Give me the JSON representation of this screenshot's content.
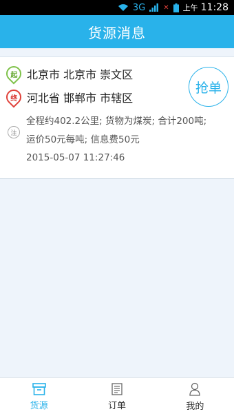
{
  "status_bar": {
    "network": "3G",
    "ampm": "上午",
    "time": "11:28",
    "icons": [
      "wifi-icon",
      "signal-icon",
      "no-sim-icon",
      "battery-icon"
    ]
  },
  "header": {
    "title": "货源消息"
  },
  "cargo": {
    "origin_badge": "起",
    "origin": "北京市 北京市 崇文区",
    "destination_badge": "终",
    "destination": "河北省 邯郸市 市辖区",
    "grab_label": "抢单",
    "note_badge": "注",
    "detail_line1": "全程约402.2公里; 货物为煤炭; 合计200吨;",
    "detail_line2": "运价50元每吨; 信息费50元",
    "timestamp": "2015-05-07 11:27:46"
  },
  "tabs": [
    {
      "label": "货源",
      "icon": "cargo-box-icon",
      "active": true
    },
    {
      "label": "订单",
      "icon": "order-list-icon",
      "active": false
    },
    {
      "label": "我的",
      "icon": "person-icon",
      "active": false
    }
  ],
  "colors": {
    "accent": "#29b2ea",
    "start_pin": "#7fc24a",
    "end_pin": "#e0413a",
    "background": "#eef4fb"
  }
}
